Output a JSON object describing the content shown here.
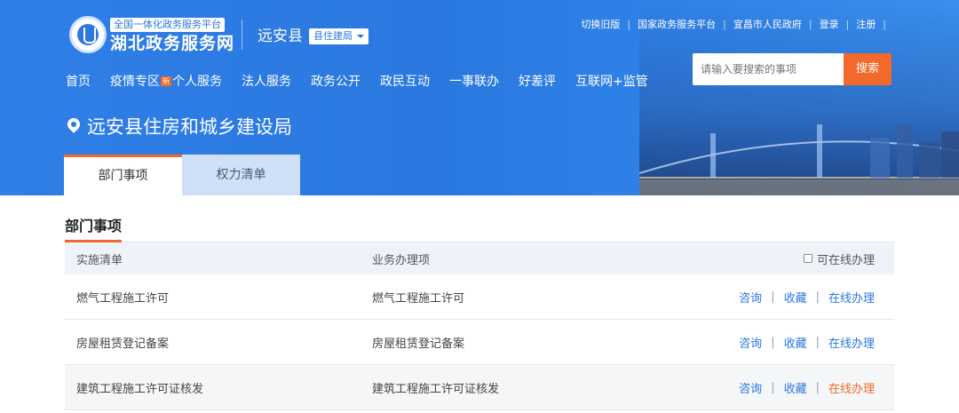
{
  "header": {
    "platform_subtitle": "全国一体化政务服务平台",
    "platform_title": "湖北政务服务网",
    "county": "远安县",
    "county_select": "县住建局",
    "top_links": [
      "切换旧版",
      "国家政务服务平台",
      "宜昌市人民政府",
      "登录",
      "注册"
    ],
    "search_placeholder": "请输入要搜索的事项",
    "search_button": "搜索",
    "nav": {
      "home": "首页",
      "epidemic": "疫情专区",
      "epidemic_badge": "新",
      "personal": "个人服务",
      "legal": "法人服务",
      "gov_open": "政务公开",
      "interaction": "政民互动",
      "one_thing": "一事联办",
      "review": "好差评",
      "internet": "互联网+监管"
    },
    "department": "远安县住房和城乡建设局",
    "tabs": [
      "部门事项",
      "权力清单"
    ]
  },
  "content": {
    "section_title": "部门事项",
    "columns": {
      "impl": "实施清单",
      "business": "业务办理项",
      "online_filter": "可在线办理"
    },
    "rows": [
      {
        "impl": "燃气工程施工许可",
        "business": "燃气工程施工许可",
        "consult": "咨询",
        "favorite": "收藏",
        "online": "在线办理"
      },
      {
        "impl": "房屋租赁登记备案",
        "business": "房屋租赁登记备案",
        "consult": "咨询",
        "favorite": "收藏",
        "online": "在线办理"
      },
      {
        "impl": "建筑工程施工许可证核发",
        "business": "建筑工程施工许可证核发",
        "consult": "咨询",
        "favorite": "收藏",
        "online": "在线办理"
      }
    ],
    "action_separator": "|"
  },
  "colors": {
    "brand_blue": "#2a78e0",
    "accent_orange": "#f3692b"
  }
}
